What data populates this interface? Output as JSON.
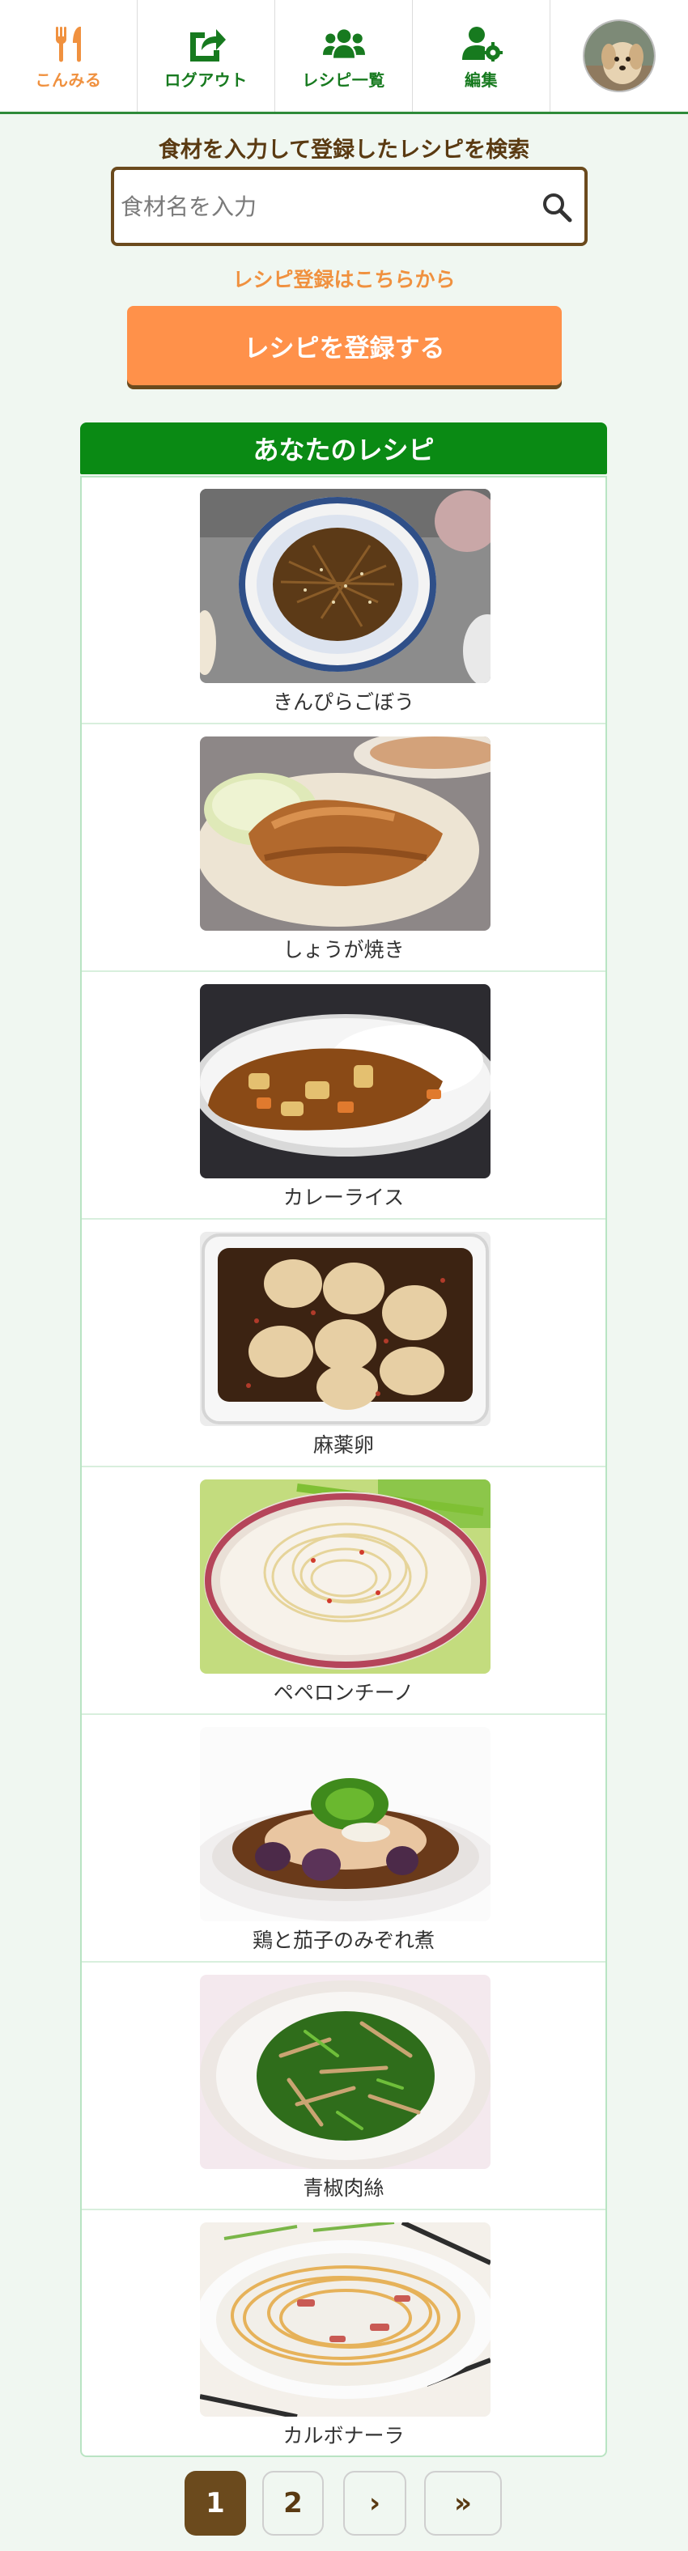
{
  "nav": {
    "items": [
      {
        "label": "こんみる",
        "icon": "utensils-icon",
        "active": true
      },
      {
        "label": "ログアウト",
        "icon": "logout-icon",
        "active": false
      },
      {
        "label": "レシピ一覧",
        "icon": "users-icon",
        "active": false
      },
      {
        "label": "編集",
        "icon": "user-gear-icon",
        "active": false
      }
    ],
    "avatar_icon": "dog-avatar"
  },
  "search": {
    "heading": "食材を入力して登録したレシピを検索",
    "placeholder": "食材名を入力",
    "button_icon": "search-icon"
  },
  "register": {
    "link_text": "レシピ登録はこちらから",
    "button_label": "レシピを登録する"
  },
  "recipes": {
    "title": "あなたのレシピ",
    "items": [
      {
        "name": "きんぴらごぼう"
      },
      {
        "name": "しょうが焼き"
      },
      {
        "name": "カレーライス"
      },
      {
        "name": "麻薬卵"
      },
      {
        "name": "ペペロンチーノ"
      },
      {
        "name": "鶏と茄子のみぞれ煮"
      },
      {
        "name": "青椒肉絲"
      },
      {
        "name": "カルボナーラ"
      }
    ]
  },
  "pagination": {
    "current": "1",
    "page2": "2",
    "next": "›",
    "last": "»"
  },
  "colors": {
    "brand_green": "#0a8a14",
    "accent_orange": "#ff914a",
    "brown": "#6b4a1d"
  }
}
